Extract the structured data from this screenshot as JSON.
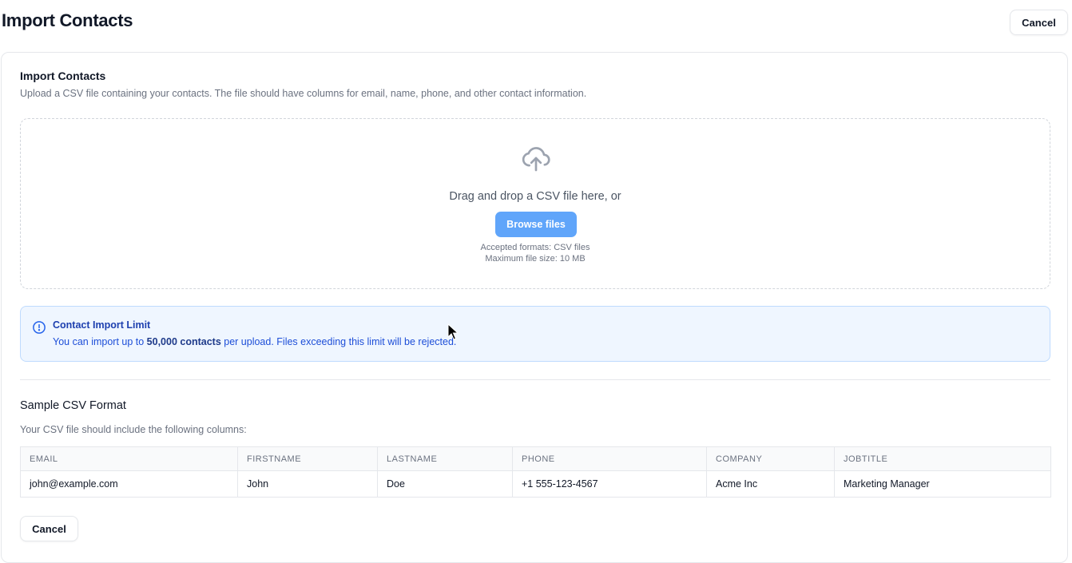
{
  "page": {
    "title": "Import Contacts",
    "cancel_label": "Cancel"
  },
  "card": {
    "title": "Import Contacts",
    "description": "Upload a CSV file containing your contacts. The file should have columns for email, name, phone, and other contact information."
  },
  "dropzone": {
    "icon": "cloud-upload-icon",
    "text": "Drag and drop a CSV file here, or",
    "browse_label": "Browse files",
    "formats_hint": "Accepted formats: CSV files",
    "size_hint": "Maximum file size: 10 MB"
  },
  "info": {
    "icon": "info-circle-icon",
    "title": "Contact Import Limit",
    "text_before": "You can import up to ",
    "text_bold": "50,000 contacts",
    "text_after": " per upload. Files exceeding this limit will be rejected."
  },
  "sample": {
    "title": "Sample CSV Format",
    "description": "Your CSV file should include the following columns:",
    "columns": [
      "EMAIL",
      "FIRSTNAME",
      "LASTNAME",
      "PHONE",
      "COMPANY",
      "JOBTITLE"
    ],
    "row": [
      "john@example.com",
      "John",
      "Doe",
      "+1 555-123-4567",
      "Acme Inc",
      "Marketing Manager"
    ]
  },
  "footer": {
    "cancel_label": "Cancel"
  },
  "colors": {
    "primary": "#60a5fa",
    "info_bg": "#eff6ff",
    "info_border": "#bfdbfe",
    "info_text": "#1d4ed8"
  }
}
